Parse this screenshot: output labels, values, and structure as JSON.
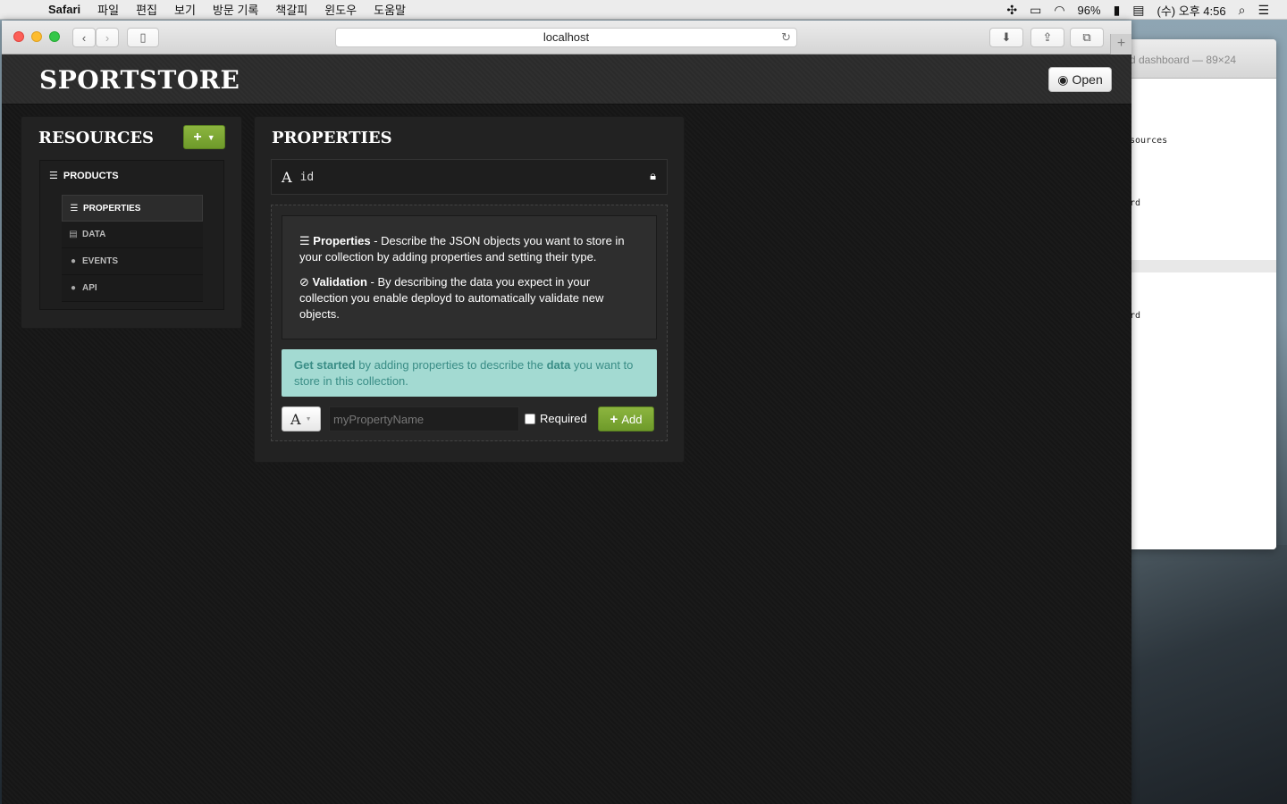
{
  "menubar": {
    "app_name": "Safari",
    "items": [
      "파일",
      "편집",
      "보기",
      "방문 기록",
      "책갈피",
      "윈도우",
      "도움말"
    ],
    "battery": "96%",
    "clock": "(수) 오후 4:56"
  },
  "terminal": {
    "title": "d dashboard — 89×24",
    "lines": [
      "sources",
      "rd",
      "rd"
    ]
  },
  "browser": {
    "address": "localhost"
  },
  "app": {
    "brand": "SPORTSTORE",
    "open_button": "Open",
    "resources": {
      "title": "RESOURCES",
      "add_button": "+",
      "resource_name": "PRODUCTS",
      "subnav": [
        {
          "label": "PROPERTIES",
          "icon": "list-icon",
          "active": true
        },
        {
          "label": "DATA",
          "icon": "table-icon",
          "active": false
        },
        {
          "label": "EVENTS",
          "icon": "info-icon",
          "active": false
        },
        {
          "label": "API",
          "icon": "info-icon",
          "active": false
        }
      ]
    },
    "properties": {
      "title": "PROPERTIES",
      "id_type": "A",
      "id_name": "id",
      "info_properties_label": "Properties",
      "info_properties_text": " - Describe the JSON objects you want to store in your collection by adding properties and setting their type.",
      "info_validation_label": "Validation",
      "info_validation_text": " - By describing the data you expect in your collection you enable deployd to automatically validate new objects.",
      "tip_strong1": "Get started",
      "tip_text1": " by adding properties to describe the ",
      "tip_strong2": "data",
      "tip_text2": " you want to store in this collection.",
      "new_type": "A",
      "new_name_placeholder": "myPropertyName",
      "required_label": "Required",
      "add_label": "Add"
    }
  },
  "colors": {
    "accent_green": "#7aa733",
    "tip_bg": "#a3dad2",
    "tip_text": "#3a8d86"
  }
}
